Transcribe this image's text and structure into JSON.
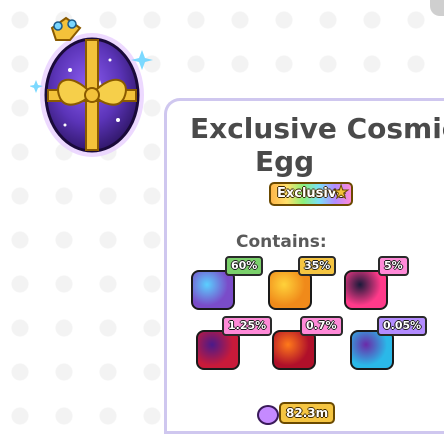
{
  "card": {
    "title_line1": "Exclusive Cosmic",
    "title_line2": "Egg",
    "exclusive_badge": "Exclusive",
    "contains_label": "Contains:",
    "timer": "82.3m"
  },
  "pets": [
    {
      "chance": "60%",
      "color": "#7a4cc9",
      "accent": "#5ad0ff"
    },
    {
      "chance": "35%",
      "color": "#f08a1a",
      "accent": "#ffd23a"
    },
    {
      "chance": "5%",
      "color": "#ff3a8a",
      "accent": "#1a1a3a"
    },
    {
      "chance": "1.25%",
      "color": "#c81a3a",
      "accent": "#4a1a8a"
    },
    {
      "chance": "0.7%",
      "color": "#b0102a",
      "accent": "#ff7a1a"
    },
    {
      "chance": "0.05%",
      "color": "#2ab8e8",
      "accent": "#6b2aa8"
    }
  ],
  "colors": {
    "card_border": "#cfc7ef",
    "exclusive_badge": "#ffb74a",
    "timer_badge": "#f5c542",
    "egg_purple": "#5b34b8",
    "ribbon_gold": "#f3c23a"
  }
}
